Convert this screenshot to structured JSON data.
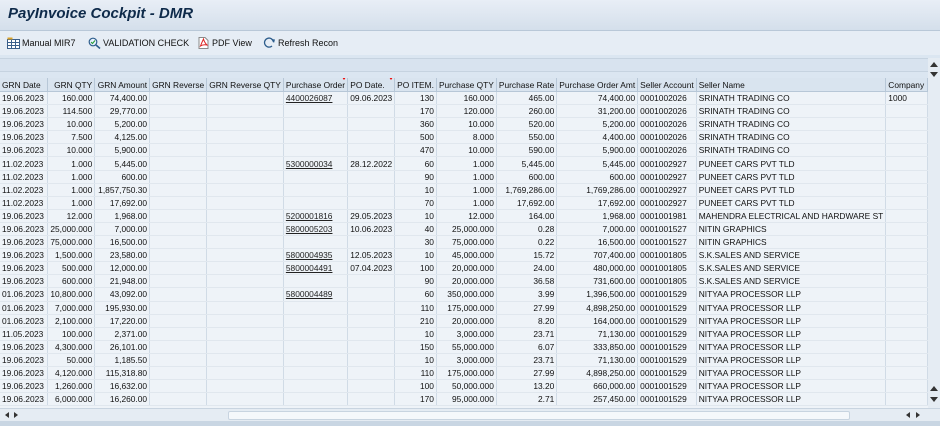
{
  "window": {
    "title": "PayInvoice Cockpit - DMR"
  },
  "toolbar": {
    "manual_mir7": "Manual MIR7",
    "validation_check": "VALIDATION CHECK",
    "pdf_view": "PDF View",
    "refresh_recon": "Refresh Recon"
  },
  "table": {
    "headers": [
      "GRN Date",
      "GRN QTY",
      "GRN Amount",
      "GRN Reverse",
      "GRN Reverse QTY",
      "Purchase Order",
      "PO Date.",
      "PO ITEM.",
      "Purchase QTY",
      "Purchase Rate",
      "Purchase Order Amt",
      "Seller Account",
      "Seller Name",
      "Company"
    ],
    "rows": [
      [
        "19.06.2023",
        "160.000",
        "74,400.00",
        "",
        "",
        "4400026087",
        "09.06.2023",
        "130",
        "160.000",
        "465.00",
        "74,400.00",
        "0001002026",
        "SRINATH TRADING CO",
        "1000"
      ],
      [
        "19.06.2023",
        "114.500",
        "29,770.00",
        "",
        "",
        "",
        "",
        "170",
        "120.000",
        "260.00",
        "31,200.00",
        "0001002026",
        "SRINATH TRADING CO",
        ""
      ],
      [
        "19.06.2023",
        "10.000",
        "5,200.00",
        "",
        "",
        "",
        "",
        "360",
        "10.000",
        "520.00",
        "5,200.00",
        "0001002026",
        "SRINATH TRADING CO",
        ""
      ],
      [
        "19.06.2023",
        "7.500",
        "4,125.00",
        "",
        "",
        "",
        "",
        "500",
        "8.000",
        "550.00",
        "4,400.00",
        "0001002026",
        "SRINATH TRADING CO",
        ""
      ],
      [
        "19.06.2023",
        "10.000",
        "5,900.00",
        "",
        "",
        "",
        "",
        "470",
        "10.000",
        "590.00",
        "5,900.00",
        "0001002026",
        "SRINATH TRADING CO",
        ""
      ],
      [
        "11.02.2023",
        "1.000",
        "5,445.00",
        "",
        "",
        "5300000034",
        "28.12.2022",
        "60",
        "1.000",
        "5,445.00",
        "5,445.00",
        "0001002927",
        "PUNEET CARS PVT TLD",
        ""
      ],
      [
        "11.02.2023",
        "1.000",
        "600.00",
        "",
        "",
        "",
        "",
        "90",
        "1.000",
        "600.00",
        "600.00",
        "0001002927",
        "PUNEET CARS PVT TLD",
        ""
      ],
      [
        "11.02.2023",
        "1.000",
        "1,857,750.30",
        "",
        "",
        "",
        "",
        "10",
        "1.000",
        "1,769,286.00",
        "1,769,286.00",
        "0001002927",
        "PUNEET CARS PVT TLD",
        ""
      ],
      [
        "11.02.2023",
        "1.000",
        "17,692.00",
        "",
        "",
        "",
        "",
        "70",
        "1.000",
        "17,692.00",
        "17,692.00",
        "0001002927",
        "PUNEET CARS PVT TLD",
        ""
      ],
      [
        "19.06.2023",
        "12.000",
        "1,968.00",
        "",
        "",
        "5200001816",
        "29.05.2023",
        "10",
        "12.000",
        "164.00",
        "1,968.00",
        "0001001981",
        "MAHENDRA ELECTRICAL AND HARDWARE ST",
        ""
      ],
      [
        "19.06.2023",
        "25,000.000",
        "7,000.00",
        "",
        "",
        "5800005203",
        "10.06.2023",
        "40",
        "25,000.000",
        "0.28",
        "7,000.00",
        "0001001527",
        "NITIN GRAPHICS",
        ""
      ],
      [
        "19.06.2023",
        "75,000.000",
        "16,500.00",
        "",
        "",
        "",
        "",
        "30",
        "75,000.000",
        "0.22",
        "16,500.00",
        "0001001527",
        "NITIN GRAPHICS",
        ""
      ],
      [
        "19.06.2023",
        "1,500.000",
        "23,580.00",
        "",
        "",
        "5800004935",
        "12.05.2023",
        "10",
        "45,000.000",
        "15.72",
        "707,400.00",
        "0001001805",
        "S.K.SALES AND SERVICE",
        ""
      ],
      [
        "19.06.2023",
        "500.000",
        "12,000.00",
        "",
        "",
        "5800004491",
        "07.04.2023",
        "100",
        "20,000.000",
        "24.00",
        "480,000.00",
        "0001001805",
        "S.K.SALES AND SERVICE",
        ""
      ],
      [
        "19.06.2023",
        "600.000",
        "21,948.00",
        "",
        "",
        "",
        "",
        "90",
        "20,000.000",
        "36.58",
        "731,600.00",
        "0001001805",
        "S.K.SALES AND SERVICE",
        ""
      ],
      [
        "01.06.2023",
        "10,800.000",
        "43,092.00",
        "",
        "",
        "5800004489",
        "",
        "60",
        "350,000.000",
        "3.99",
        "1,396,500.00",
        "0001001529",
        "NITYAA PROCESSOR LLP",
        ""
      ],
      [
        "01.06.2023",
        "7,000.000",
        "195,930.00",
        "",
        "",
        "",
        "",
        "110",
        "175,000.000",
        "27.99",
        "4,898,250.00",
        "0001001529",
        "NITYAA PROCESSOR LLP",
        ""
      ],
      [
        "01.06.2023",
        "2,100.000",
        "17,220.00",
        "",
        "",
        "",
        "",
        "210",
        "20,000.000",
        "8.20",
        "164,000.00",
        "0001001529",
        "NITYAA PROCESSOR LLP",
        ""
      ],
      [
        "11.05.2023",
        "100.000",
        "2,371.00",
        "",
        "",
        "",
        "",
        "10",
        "3,000.000",
        "23.71",
        "71,130.00",
        "0001001529",
        "NITYAA PROCESSOR LLP",
        ""
      ],
      [
        "19.06.2023",
        "4,300.000",
        "26,101.00",
        "",
        "",
        "",
        "",
        "150",
        "55,000.000",
        "6.07",
        "333,850.00",
        "0001001529",
        "NITYAA PROCESSOR LLP",
        ""
      ],
      [
        "19.06.2023",
        "50.000",
        "1,185.50",
        "",
        "",
        "",
        "",
        "10",
        "3,000.000",
        "23.71",
        "71,130.00",
        "0001001529",
        "NITYAA PROCESSOR LLP",
        ""
      ],
      [
        "19.06.2023",
        "4,120.000",
        "115,318.80",
        "",
        "",
        "",
        "",
        "110",
        "175,000.000",
        "27.99",
        "4,898,250.00",
        "0001001529",
        "NITYAA PROCESSOR LLP",
        ""
      ],
      [
        "19.06.2023",
        "1,260.000",
        "16,632.00",
        "",
        "",
        "",
        "",
        "100",
        "50,000.000",
        "13.20",
        "660,000.00",
        "0001001529",
        "NITYAA PROCESSOR LLP",
        ""
      ],
      [
        "19.06.2023",
        "6,000.000",
        "16,260.00",
        "",
        "",
        "",
        "",
        "170",
        "95,000.000",
        "2.71",
        "257,450.00",
        "0001001529",
        "NITYAA PROCESSOR LLP",
        ""
      ]
    ]
  }
}
